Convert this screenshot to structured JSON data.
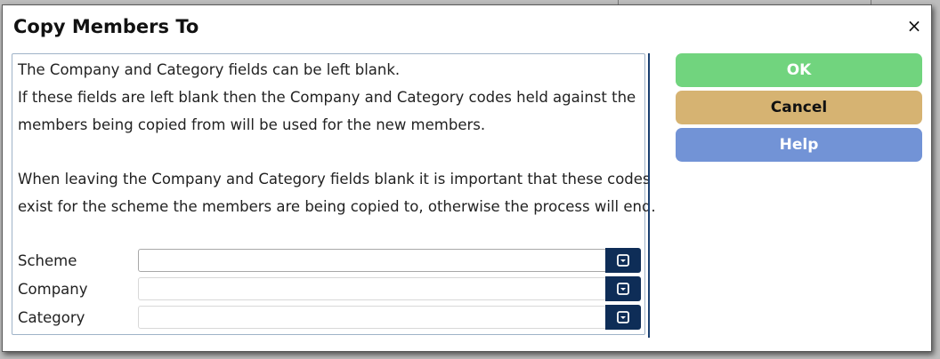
{
  "dialog": {
    "title": "Copy Members To",
    "close_glyph": "×"
  },
  "info": {
    "line1": "The Company and Category fields can be left blank.",
    "line2": "If these fields are left blank then the Company and Category codes held against the",
    "line3": "members being copied from will be used for the new members.",
    "line4": "When leaving the Company and Category fields blank it is important that these codes",
    "line5": "exist for the scheme the members are being copied to, otherwise the process will end."
  },
  "fields": {
    "scheme": {
      "label": "Scheme",
      "value": ""
    },
    "company": {
      "label": "Company",
      "value": ""
    },
    "category": {
      "label": "Category",
      "value": ""
    }
  },
  "buttons": {
    "ok": "OK",
    "cancel": "Cancel",
    "help": "Help"
  },
  "colors": {
    "ok": "#71d47e",
    "cancel": "#d6b372",
    "help": "#7293d6",
    "dropdown": "#0e2d57"
  },
  "icons": {
    "close": "close-icon",
    "dropdown": "dropdown-icon"
  }
}
